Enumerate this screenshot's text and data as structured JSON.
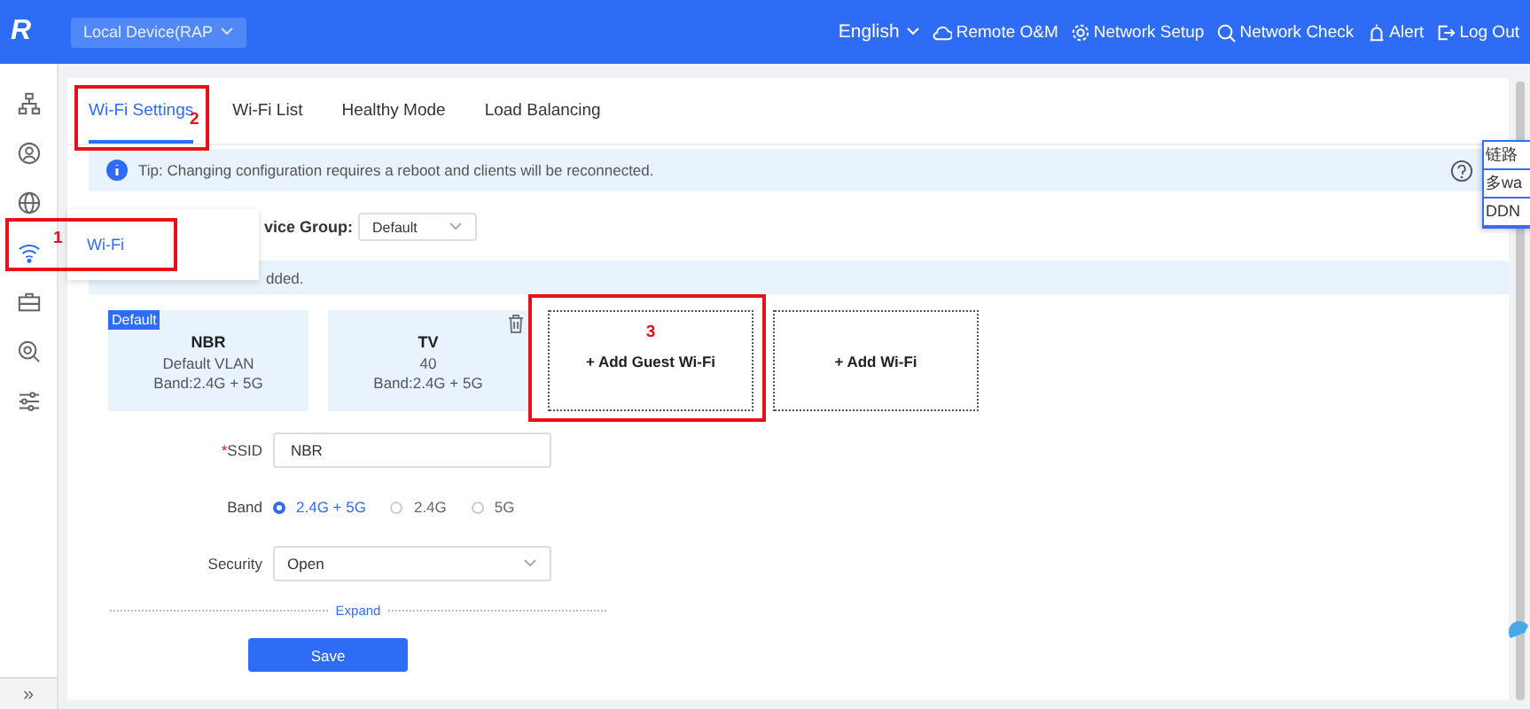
{
  "header": {
    "logo": "R",
    "device": "Local Device(RAP",
    "language": "English",
    "actions": [
      {
        "label": "Remote O&M"
      },
      {
        "label": "Network Setup"
      },
      {
        "label": "Network Check"
      },
      {
        "label": "Alert"
      },
      {
        "label": "Log Out"
      }
    ]
  },
  "sidebar": {
    "items": [
      {
        "selected": false
      },
      {
        "selected": false
      },
      {
        "selected": false
      },
      {
        "selected": true
      },
      {
        "selected": false
      },
      {
        "selected": false
      },
      {
        "selected": false
      }
    ],
    "collapse": "»"
  },
  "flyout": {
    "item": "Wi-Fi",
    "marker": "1"
  },
  "tabs": [
    {
      "label": "Wi-Fi Settings",
      "selected": true,
      "marker": "2"
    },
    {
      "label": "Wi-Fi List",
      "selected": false
    },
    {
      "label": "Healthy Mode",
      "selected": false
    },
    {
      "label": "Load Balancing",
      "selected": false
    }
  ],
  "tip": "Tip: Changing configuration requires a reboot and clients will be reconnected.",
  "device_group": {
    "label": "vice Group:",
    "value": "Default"
  },
  "notice": "dded.",
  "wifi_cards": [
    {
      "kind": "network",
      "badge": "Default",
      "name": "NBR",
      "line_2": "Default VLAN",
      "band": "Band:2.4G + 5G",
      "deletable": false
    },
    {
      "kind": "network",
      "name": "TV",
      "line_2": "40",
      "band": "Band:2.4G + 5G",
      "deletable": true
    },
    {
      "kind": "add",
      "label": "+ Add Guest Wi-Fi",
      "marker": "3"
    },
    {
      "kind": "add",
      "label": "+ Add Wi-Fi"
    }
  ],
  "form": {
    "ssid": {
      "label": "SSID",
      "required_mark": "*",
      "value": "NBR"
    },
    "band": {
      "label": "Band",
      "options": [
        {
          "label": "2.4G + 5G",
          "selected": true
        },
        {
          "label": "2.4G",
          "selected": false
        },
        {
          "label": "5G",
          "selected": false
        }
      ]
    },
    "security": {
      "label": "Security",
      "value": "Open"
    },
    "expand": "Expand",
    "save": "Save"
  },
  "overlay_menu": [
    "链路",
    "多wa",
    "DDN"
  ]
}
